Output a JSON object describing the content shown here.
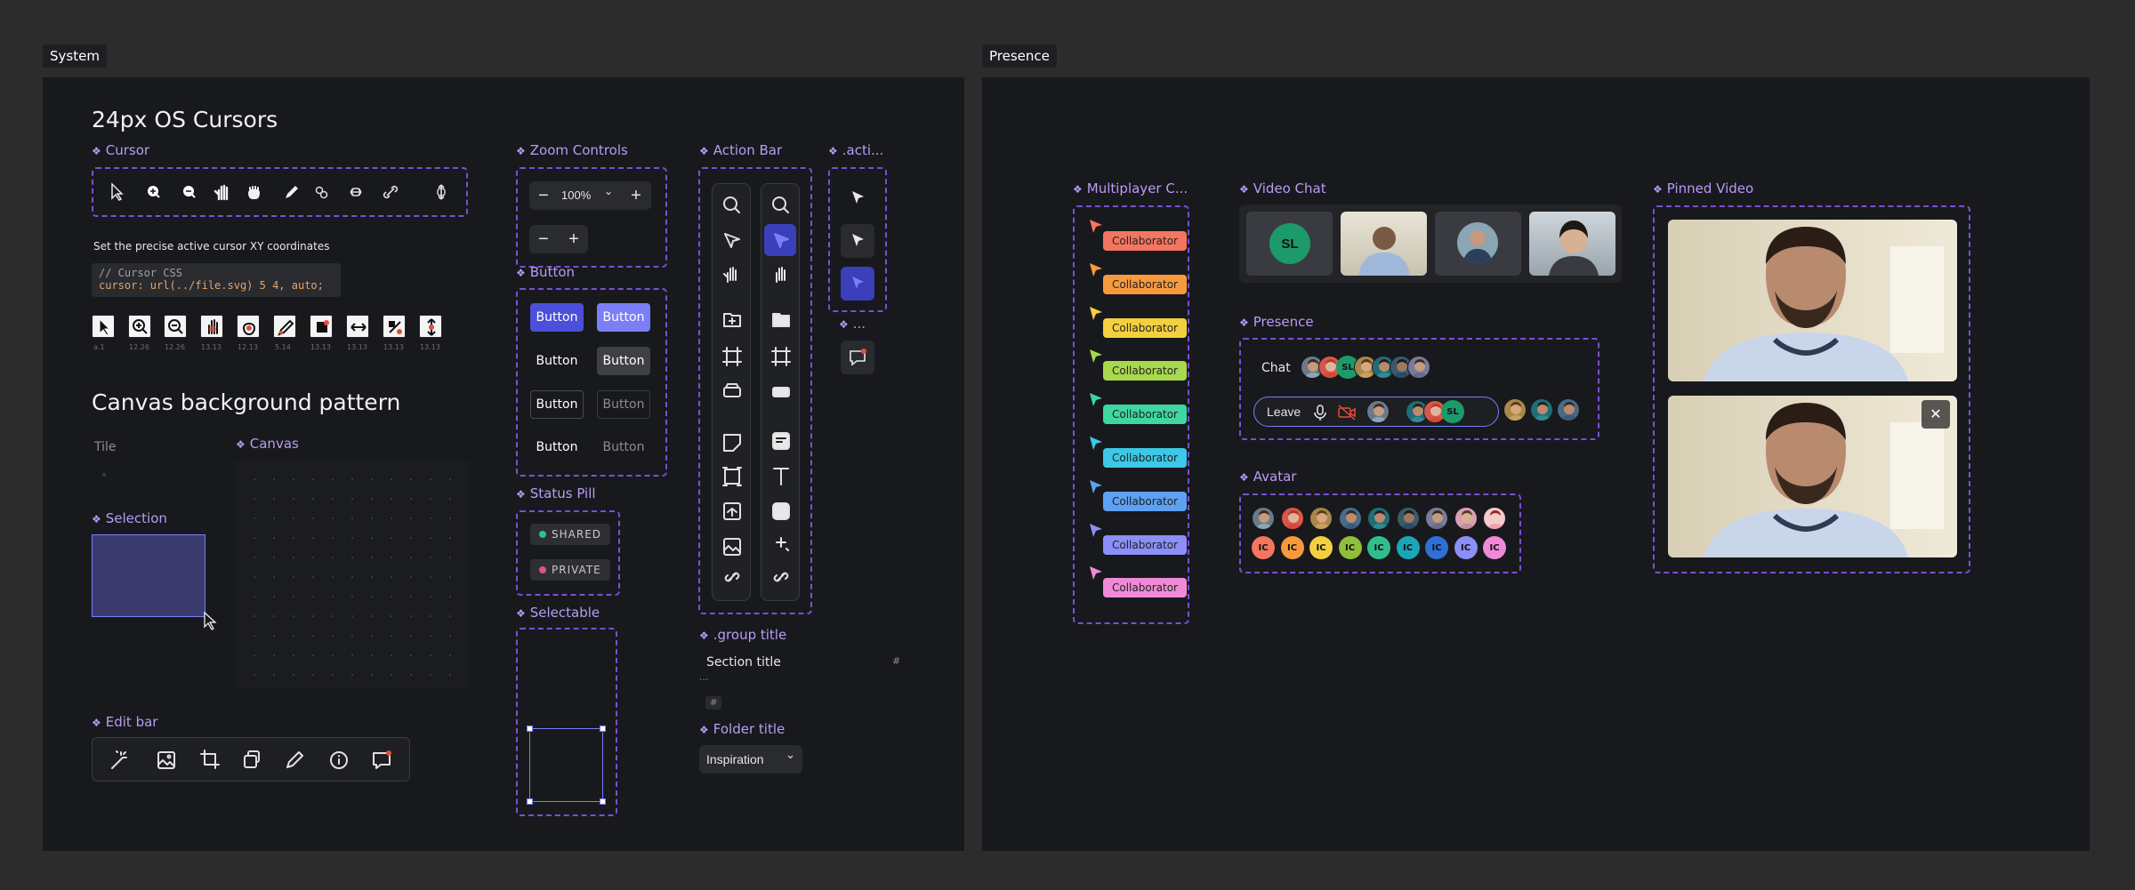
{
  "frames": {
    "system_label": "System",
    "presence_label": "Presence"
  },
  "system": {
    "title_cursors": "24px OS Cursors",
    "cursor_label": "Cursor",
    "cursor_icons": [
      "arrow-icon",
      "zoom-in-icon",
      "zoom-out-icon",
      "hand-icon",
      "grab-icon",
      "pencil-icon",
      "link-icon",
      "resize-horizontal-icon",
      "link-diagonal-icon",
      "resize-vertical-icon"
    ],
    "xy_caption": "Set the precise active cursor XY coordinates",
    "code_line1": "// Cursor CSS",
    "code_line2": "cursor: url(../file.svg) 5 4, auto;",
    "cursor_tile_captions": [
      "a.1",
      "12.26",
      "12.26",
      "13.13",
      "12.13",
      "5.14",
      "13.13",
      "13.13",
      "13.13",
      "13.13"
    ],
    "canvas_bg_title": "Canvas background pattern",
    "tile_label": "Tile",
    "canvas_label": "Canvas",
    "selection_label": "Selection",
    "edit_bar_label": "Edit bar",
    "zoom_controls_label": "Zoom Controls",
    "zoom_value": "100%",
    "zoom_chevron": "⌄",
    "minus": "−",
    "plus": "+",
    "button_label": "Button",
    "button_text": "Button",
    "status_pill_label": "Status Pill",
    "pill_shared": "SHARED",
    "pill_private": "PRIVATE",
    "selectable_label": "Selectable",
    "action_bar_label": "Action Bar",
    "acti_label": ".acti...",
    "ellipsis_label": "...",
    "group_title_label": ".group title",
    "section_title": "Section title",
    "hash": "#",
    "section_ellipsis": "...",
    "folder_title_label": "Folder title",
    "folder_value": "Inspiration",
    "colors": {
      "accent": "#b79cf5",
      "primary_button": "#4b4fd9",
      "primary_button_hover": "#7a7ef7",
      "selection_fill": "#3a3a6e",
      "shared": "#2fbf8f",
      "private": "#e0518b"
    }
  },
  "presence": {
    "multiplayer_label": "Multiplayer C...",
    "collaborator_text": "Collaborator",
    "collaborator_colors": [
      "#f47560",
      "#f79a3e",
      "#f4d03f",
      "#a8d84e",
      "#3ed6a1",
      "#3cc8e6",
      "#5ea0f2",
      "#8b8ff7",
      "#f08ad6"
    ],
    "video_chat_label": "Video Chat",
    "sl": "SL",
    "presence_label": "Presence",
    "chat_text": "Chat",
    "leave_text": "Leave",
    "avatar_label": "Avatar",
    "ic": "IC",
    "ic_colors": [
      "#f47560",
      "#f79a3e",
      "#f4d03f",
      "#8fbf3a",
      "#2fbf8f",
      "#1aa6b7",
      "#2f6fd6",
      "#8b8ff7",
      "#f08ad6"
    ],
    "pinned_video_label": "Pinned Video",
    "close_glyph": "✕"
  }
}
